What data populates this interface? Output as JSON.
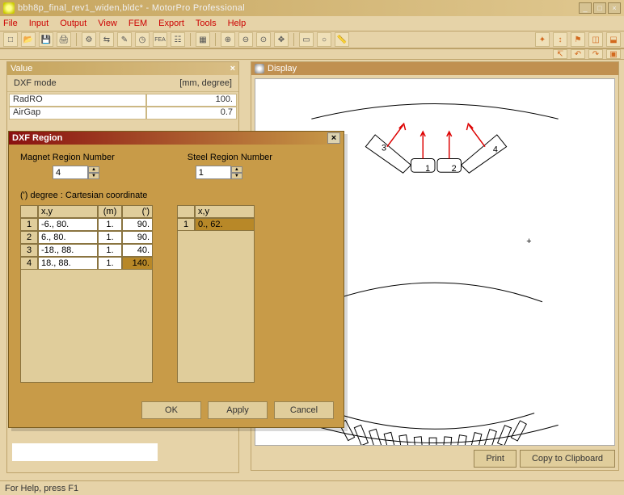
{
  "window": {
    "title": "bbh8p_final_rev1_widen,bldc* - MotorPro Professional",
    "min": "_",
    "max": "□",
    "close": "×"
  },
  "menu": [
    "File",
    "Input",
    "Output",
    "View",
    "FEM",
    "Export",
    "Tools",
    "Help"
  ],
  "value_panel": {
    "title": "Value",
    "close": "×",
    "sub_left": "DXF mode",
    "sub_right": "[mm, degree]",
    "rows": [
      {
        "k": "RadRO",
        "v": "100."
      },
      {
        "k": "AirGap",
        "v": "0.7"
      }
    ]
  },
  "display": {
    "title": "Display",
    "print": "Print",
    "copy": "Copy to Clipboard",
    "markers": [
      "1",
      "2",
      "3",
      "4",
      "+"
    ]
  },
  "status": "For Help, press F1",
  "dialog": {
    "title": "DXF Region",
    "close": "×",
    "magnet_label": "Magnet Region Number",
    "steel_label": "Steel Region Number",
    "magnet_value": "4",
    "steel_value": "1",
    "note": "(') degree : Cartesian coordinate",
    "t1_head": {
      "xy": "x,y",
      "m": "(m)",
      "ang": "(')"
    },
    "t1_rows": [
      {
        "i": "1",
        "xy": "-6., 80.",
        "m": "1.",
        "ang": "90."
      },
      {
        "i": "2",
        "xy": "6., 80.",
        "m": "1.",
        "ang": "90."
      },
      {
        "i": "3",
        "xy": "-18., 88.",
        "m": "1.",
        "ang": "40."
      },
      {
        "i": "4",
        "xy": "18., 88.",
        "m": "1.",
        "ang": "140."
      }
    ],
    "t2_head": {
      "xy": "x,y"
    },
    "t2_rows": [
      {
        "i": "1",
        "xy": "0., 62."
      }
    ],
    "ok": "OK",
    "apply": "Apply",
    "cancel": "Cancel"
  }
}
